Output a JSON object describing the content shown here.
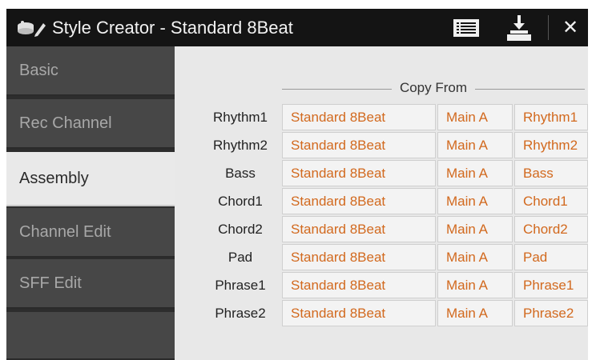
{
  "titlebar": {
    "title": "Style Creator - Standard 8Beat",
    "icons": {
      "app": "style-creator-icon",
      "list": "list-icon",
      "save": "save-download-icon",
      "close": "close-icon"
    },
    "close_glyph": "✕"
  },
  "sidebar": {
    "tabs": [
      {
        "label": "Basic",
        "active": false
      },
      {
        "label": "Rec Channel",
        "active": false
      },
      {
        "label": "Assembly",
        "active": true
      },
      {
        "label": "Channel Edit",
        "active": false
      },
      {
        "label": "SFF Edit",
        "active": false
      },
      {
        "label": "",
        "active": false
      }
    ]
  },
  "main": {
    "section_label": "Copy From",
    "rows": [
      {
        "label": "Rhythm1",
        "style": "Standard 8Beat",
        "section": "Main A",
        "channel": "Rhythm1"
      },
      {
        "label": "Rhythm2",
        "style": "Standard 8Beat",
        "section": "Main A",
        "channel": "Rhythm2"
      },
      {
        "label": "Bass",
        "style": "Standard 8Beat",
        "section": "Main A",
        "channel": "Bass"
      },
      {
        "label": "Chord1",
        "style": "Standard 8Beat",
        "section": "Main A",
        "channel": "Chord1"
      },
      {
        "label": "Chord2",
        "style": "Standard 8Beat",
        "section": "Main A",
        "channel": "Chord2"
      },
      {
        "label": "Pad",
        "style": "Standard 8Beat",
        "section": "Main A",
        "channel": "Pad"
      },
      {
        "label": "Phrase1",
        "style": "Standard 8Beat",
        "section": "Main A",
        "channel": "Phrase1"
      },
      {
        "label": "Phrase2",
        "style": "Standard 8Beat",
        "section": "Main A",
        "channel": "Phrase2"
      }
    ]
  },
  "colors": {
    "accent": "#d2691e",
    "titlebar": "#141414",
    "active_tab": "#e9e9e9",
    "panel": "#e8e8e8"
  }
}
